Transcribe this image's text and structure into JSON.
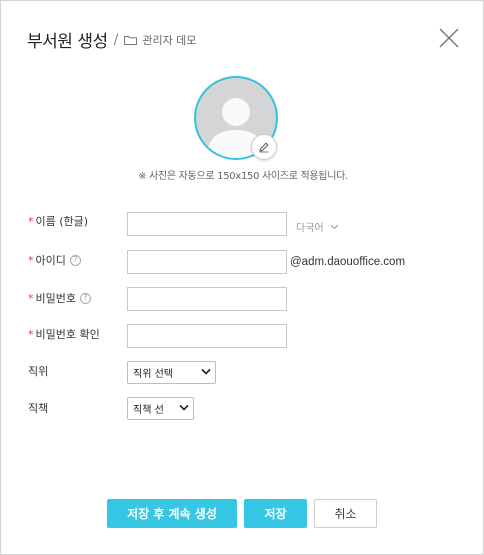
{
  "header": {
    "title": "부서원 생성",
    "separator": "/",
    "org_name": "관리자 데모"
  },
  "photo": {
    "note": "※ 사진은 자동으로 150x150 사이즈로 적용됩니다.",
    "border_color": "#35c2dd"
  },
  "form": {
    "name": {
      "required_mark": "*",
      "label": "이름 (한글)",
      "value": "",
      "lang_link": "다국어"
    },
    "id": {
      "required_mark": "*",
      "label": "아이디",
      "help": "?",
      "value": "",
      "domain": "@adm.daouoffice.com"
    },
    "password": {
      "required_mark": "*",
      "label": "비밀번호",
      "help": "?",
      "value": ""
    },
    "password_confirm": {
      "required_mark": "*",
      "label": "비밀번호 확인",
      "value": ""
    },
    "position": {
      "label": "직위",
      "selected": "직위 선택"
    },
    "duty": {
      "label": "직책",
      "selected": "직책 선"
    }
  },
  "footer": {
    "save_continue_label": "저장 후 계속 생성",
    "save_label": "저장",
    "cancel_label": "취소"
  },
  "colors": {
    "accent": "#35c7e4",
    "required": "#e0393e"
  }
}
